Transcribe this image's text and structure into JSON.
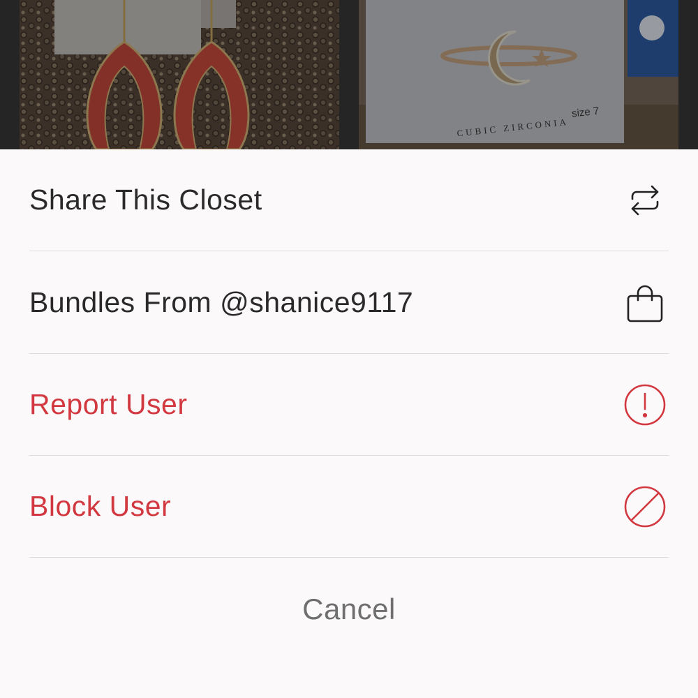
{
  "background": {
    "left_photo": "earrings-photo",
    "right_photo": "ring-photo",
    "ring_card_text": "CUBIC ZIRCONIA",
    "ring_size_text": "size 7"
  },
  "action_sheet": {
    "items": [
      {
        "label": "Share This Closet",
        "icon": "share-repeat-icon",
        "style": "default"
      },
      {
        "label": "Bundles From @shanice9117",
        "icon": "shopping-bag-icon",
        "style": "default"
      },
      {
        "label": "Report User",
        "icon": "exclamation-circle-icon",
        "style": "danger"
      },
      {
        "label": "Block User",
        "icon": "block-circle-icon",
        "style": "danger"
      }
    ],
    "cancel_label": "Cancel"
  },
  "colors": {
    "danger": "#d2383f",
    "text": "#2a2a2a",
    "cancel": "#6f6f6f",
    "sheet_bg": "#fbf9fa",
    "divider": "#dcdcdc"
  }
}
